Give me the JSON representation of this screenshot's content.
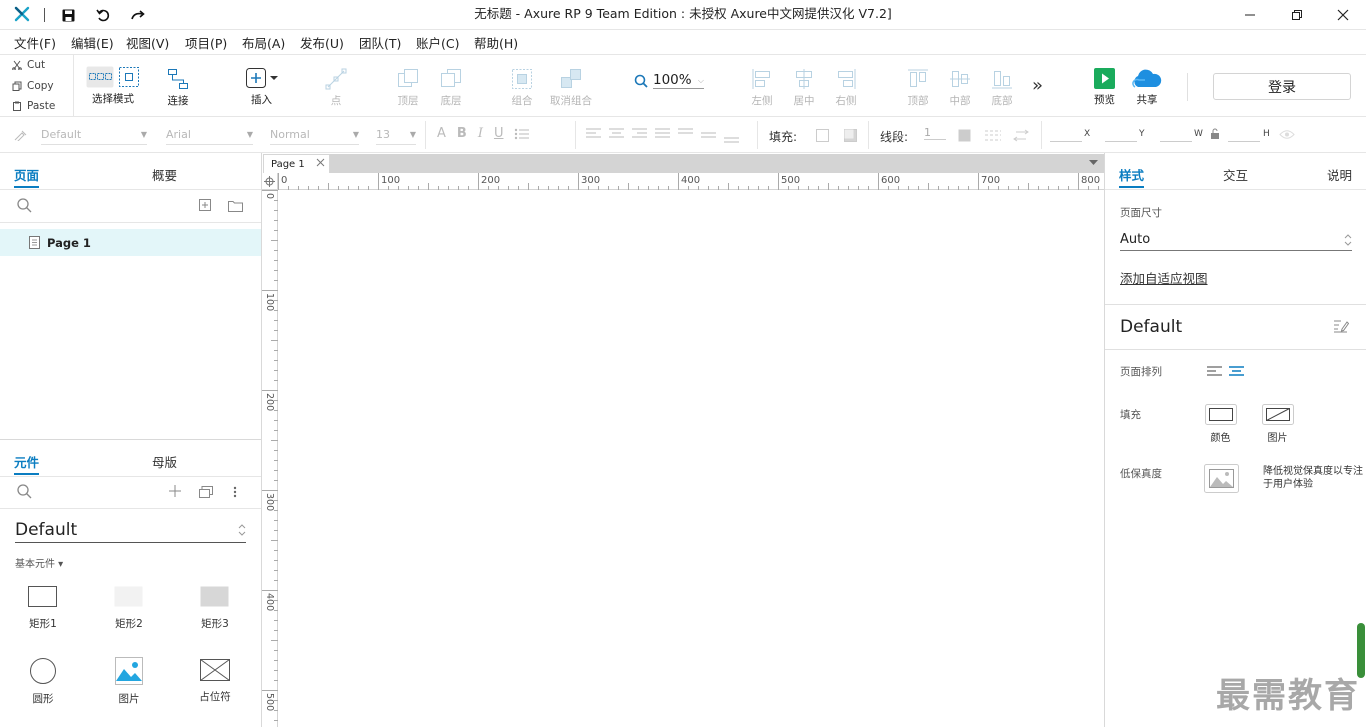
{
  "window": {
    "title": "无标题 - Axure RP 9 Team Edition : 未授权     Axure中文网提供汉化 V7.2]"
  },
  "menu": [
    "文件(F)",
    "编辑(E)",
    "视图(V)",
    "项目(P)",
    "布局(A)",
    "发布(U)",
    "团队(T)",
    "账户(C)",
    "帮助(H)"
  ],
  "clipboard": {
    "cut": "Cut",
    "copy": "Copy",
    "paste": "Paste"
  },
  "toolbar": {
    "select_mode": "选择模式",
    "connect": "连接",
    "insert": "插入",
    "point": "点",
    "top_layer": "顶层",
    "bottom_layer": "底层",
    "group": "组合",
    "ungroup": "取消组合",
    "zoom": "100%",
    "align_left": "左侧",
    "align_center": "居中",
    "align_right": "右侧",
    "align_top": "顶部",
    "align_middle": "中部",
    "align_bottom": "底部",
    "more": "»",
    "preview": "预览",
    "share": "共享",
    "login": "登录"
  },
  "format": {
    "style": "Default",
    "font": "Arial",
    "weight": "Normal",
    "size": "13",
    "fill_label": "填充:",
    "stroke_label": "线段:",
    "stroke_value": "1",
    "x": "X",
    "y": "Y",
    "w": "W",
    "h": "H"
  },
  "left_top": {
    "tab_pages": "页面",
    "tab_outline": "概要",
    "page_item": "Page 1"
  },
  "left_bottom": {
    "tab_widgets": "元件",
    "tab_masters": "母版",
    "library": "Default",
    "category": "基本元件 ▾",
    "widgets": [
      "矩形1",
      "矩形2",
      "矩形3",
      "圆形",
      "图片",
      "占位符"
    ]
  },
  "canvas": {
    "doc_tab": "Page 1",
    "h_ticks": [
      "0",
      "100",
      "200",
      "300",
      "400",
      "500",
      "600",
      "700",
      "800"
    ],
    "v_ticks": [
      "0",
      "100",
      "200",
      "300",
      "400",
      "500"
    ]
  },
  "right": {
    "tab_style": "样式",
    "tab_interact": "交互",
    "tab_notes": "说明",
    "page_size_label": "页面尺寸",
    "page_size_value": "Auto",
    "adaptive_link": "添加自适应视图",
    "style_name": "Default",
    "page_align_label": "页面排列",
    "fill_label": "填充",
    "fill_color": "颜色",
    "fill_image": "图片",
    "low_fidelity_label": "低保真度",
    "low_fidelity_desc": "降低视觉保真度以专注于用户体验"
  },
  "watermark": "最需教育",
  "colors": {
    "accent": "#0b7dc1",
    "selected_row": "#e3f6f9",
    "preview_green": "#1aab5c",
    "share_blue": "#1e8fe0"
  }
}
